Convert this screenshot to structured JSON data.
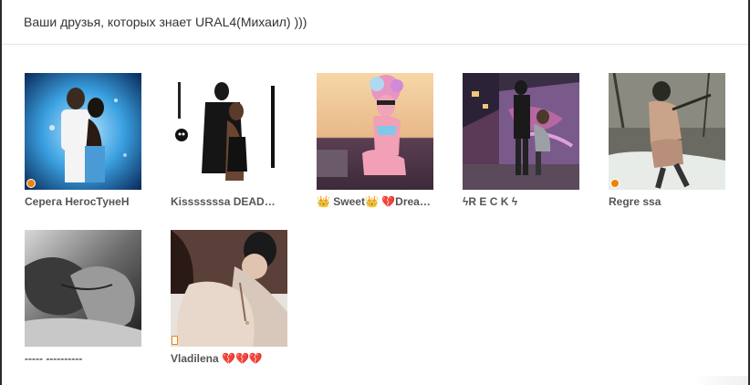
{
  "modal": {
    "title": "Ваши друзья, которых знает URAL4(Михаил) )))"
  },
  "friends": [
    {
      "name": "Серега НегосТунеН",
      "status": "online"
    },
    {
      "name": "Kisssssssa DEAD…",
      "status": "none"
    },
    {
      "name": "👑 Sweet👑 💔Dreams 💔",
      "status": "none"
    },
    {
      "name": "ϟR E C K ϟ",
      "status": "none"
    },
    {
      "name": "Regre ssa",
      "status": "online"
    },
    {
      "name": "----- ----------",
      "status": "none"
    },
    {
      "name": "Vladilena 💔💔💔",
      "status": "mobile"
    }
  ],
  "colors": {
    "online_indicator": "#ee8208",
    "name_text": "#555555",
    "title_text": "#333333"
  }
}
